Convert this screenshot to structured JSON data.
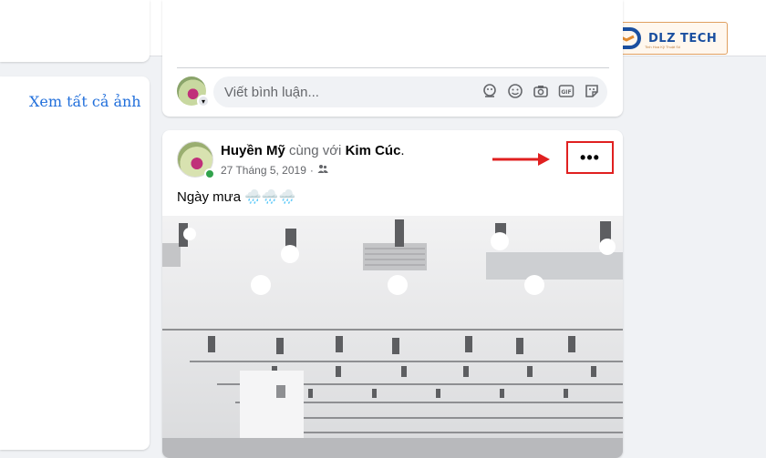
{
  "topbar": {
    "more_label": "•••"
  },
  "logo": {
    "text": "DLZ TECH",
    "tagline": "Tinh Hoa Kỹ Thuật Số"
  },
  "left_panel": {
    "see_all_photos": "Xem tất cả ảnh"
  },
  "comment_box": {
    "placeholder": "Viết bình luận...",
    "icons": [
      "avatar-sticker-icon",
      "emoji-icon",
      "camera-icon",
      "gif-icon",
      "sticker-icon"
    ]
  },
  "post": {
    "author": "Huyền Mỹ",
    "with_text": "cùng với",
    "tagged": "Kim Cúc",
    "tagged_suffix": ".",
    "date": "27 Tháng 5, 2019",
    "privacy": "·",
    "more_label": "•••",
    "text": "Ngày mưa 🌧️🌧️🌧️"
  },
  "colors": {
    "highlight": "#e02020",
    "link": "#216fdb",
    "online": "#31a24c"
  }
}
